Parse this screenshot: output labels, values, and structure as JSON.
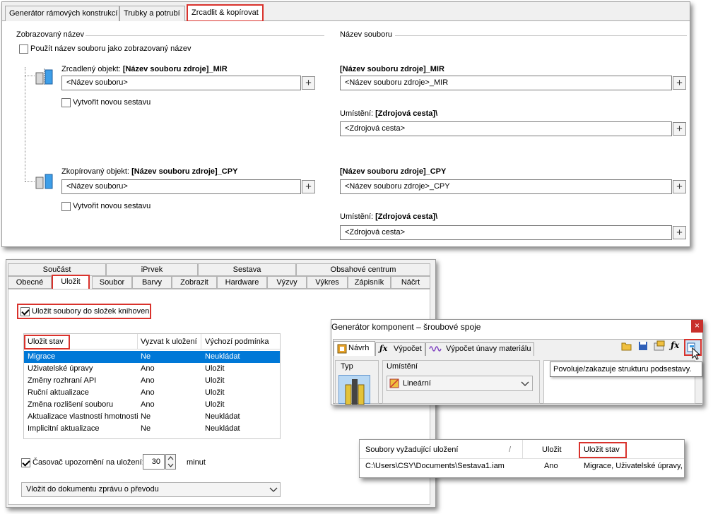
{
  "panel1": {
    "tabs": [
      "Generátor rámových konstrukcí",
      "Trubky a potrubí",
      "Zrcadlit & kopírovat"
    ],
    "display_name_header": "Zobrazovaný název",
    "file_name_header": "Název souboru",
    "use_filename_label": "Použít název souboru jako zobrazovaný název",
    "mirror_label": "Zrcadlený objekt: ",
    "mirror_bold": "[Název souboru zdroje]_MIR",
    "mirror_field": "<Název souboru>",
    "create_asm_label": "Vytvořit novou sestavu",
    "mirror_file_bold": "[Název souboru zdroje]_MIR",
    "mirror_file_field": "<Název souboru zdroje>_MIR",
    "location_label": "Umístění: ",
    "location_bold": "[Zdrojová cesta]\\",
    "location_field": "<Zdrojová cesta>",
    "copy_label": "Zkopírovaný objekt: ",
    "copy_bold": "[Název souboru zdroje]_CPY",
    "copy_field": "<Název souboru>",
    "copy_file_bold": "[Název souboru zdroje]_CPY",
    "copy_file_field": "<Název souboru zdroje>_CPY",
    "plus": "+"
  },
  "panel2": {
    "tabs_top": [
      "Součást",
      "iPrvek",
      "Sestava",
      "Obsahové centrum"
    ],
    "tabs_bottom": [
      "Obecné",
      "Uložit",
      "Soubor",
      "Barvy",
      "Zobrazit",
      "Hardware",
      "Výzvy",
      "Výkres",
      "Zápisník",
      "Náčrt"
    ],
    "save_lib_label": "Uložit soubory do složek knihoven",
    "columns": [
      "Uložit stav",
      "Vyzvat k uložení",
      "Výchozí podmínka"
    ],
    "rows": [
      [
        "Migrace",
        "Ne",
        "Neukládat"
      ],
      [
        "Uživatelské úpravy",
        "Ano",
        "Uložit"
      ],
      [
        "Změny rozhraní API",
        "Ano",
        "Uložit"
      ],
      [
        "Ruční aktualizace",
        "Ano",
        "Uložit"
      ],
      [
        "Změna rozlišení souboru",
        "Ano",
        "Uložit"
      ],
      [
        "Aktualizace vlastností hmotnosti",
        "Ne",
        "Neukládat"
      ],
      [
        "Implicitní aktualizace",
        "Ne",
        "Neukládat"
      ]
    ],
    "timer_label": "Časovač upozornění na uložení:",
    "timer_value": "30",
    "timer_unit": "minut",
    "dropdown": "Vložit do dokumentu zprávu o převodu"
  },
  "panel3": {
    "title": "Generátor komponent – šroubové spoje",
    "close": "×",
    "tabs": [
      "Návrh",
      "Výpočet",
      "Výpočet únavy materiálu"
    ],
    "typ_label": "Typ",
    "umisteni_label": "Umístění",
    "placement_value": "Lineární",
    "tooltip": "Povoluje/zakazuje strukturu podsestavy."
  },
  "panel4": {
    "columns": [
      "Soubory vyžadující uložení",
      "Uložit",
      "Uložit stav"
    ],
    "row": [
      "C:\\Users\\CSY\\Documents\\Sestava1.iam",
      "Ano",
      "Migrace, Uživatelské úpravy,"
    ]
  }
}
